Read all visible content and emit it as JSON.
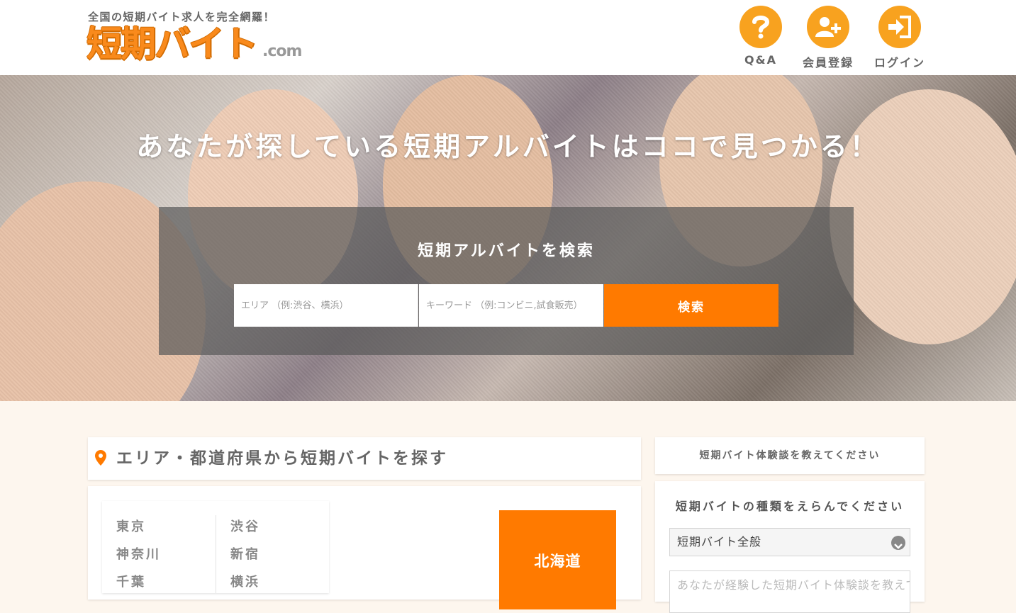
{
  "header": {
    "tagline": "全国の短期バイト求人を完全網羅！",
    "logo_text": "短期バイト",
    "logo_suffix": ".com",
    "nav": [
      {
        "label": "Q&A",
        "icon": "question-icon"
      },
      {
        "label": "会員登録",
        "icon": "user-plus-icon"
      },
      {
        "label": "ログイン",
        "icon": "login-icon"
      }
    ]
  },
  "hero": {
    "title": "あなたが探している短期アルバイトはココで見つかる！",
    "search_heading": "短期アルバイトを検索",
    "area_placeholder": "エリア （例:渋谷、横浜）",
    "keyword_placeholder": "キーワード （例:コンビニ,試食販売）",
    "search_button": "検索"
  },
  "area_section": {
    "title": "エリア・都道府県から短期バイトを探す",
    "cities_col1": [
      "東京",
      "神奈川",
      "千葉"
    ],
    "cities_col2": [
      "渋谷",
      "新宿",
      "横浜"
    ],
    "region": "北海道"
  },
  "sidebar": {
    "experience_heading": "短期バイト体験談を教えてください",
    "form_title": "短期バイトの種類をえらんでください",
    "select_value": "短期バイト全般",
    "textarea_placeholder": "あなたが経験した短期バイト体験談を教えてください"
  },
  "colors": {
    "accent": "#ff7a00",
    "nav_circle": "#f8a21f",
    "page_bg": "#fdf6ee"
  }
}
